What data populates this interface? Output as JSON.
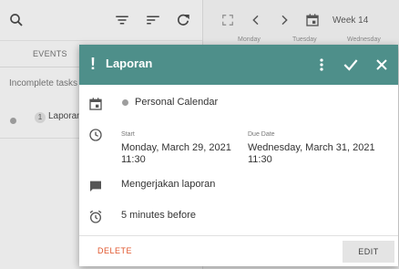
{
  "left_panel": {
    "events_header": "EVENTS",
    "section_label": "Incomplete tasks",
    "task": {
      "badge": "1",
      "label": "Laporan"
    }
  },
  "right_panel": {
    "week_label": "Week 14",
    "day_headers": [
      "Monday",
      "Tuesday",
      "Wednesday"
    ]
  },
  "dialog": {
    "title": "Laporan",
    "calendar": "Personal Calendar",
    "start_label": "Start",
    "start_date": "Monday, March 29, 2021",
    "start_time": "11:30",
    "due_label": "Due Date",
    "due_date": "Wednesday, March 31, 2021",
    "due_time": "11:30",
    "description": "Mengerjakan laporan",
    "reminder": "5 minutes before",
    "delete_label": "DELETE",
    "edit_label": "EDIT"
  },
  "colors": {
    "header": "#4e8f8a",
    "delete": "#e0552b"
  },
  "icons": [
    "search-icon",
    "filter-icon",
    "sort-icon",
    "refresh-icon",
    "expand-icon",
    "chevron-left-icon",
    "chevron-right-icon",
    "calendar-icon",
    "more-vert-icon",
    "check-icon",
    "close-icon",
    "clock-icon",
    "comment-icon",
    "alarm-icon"
  ]
}
